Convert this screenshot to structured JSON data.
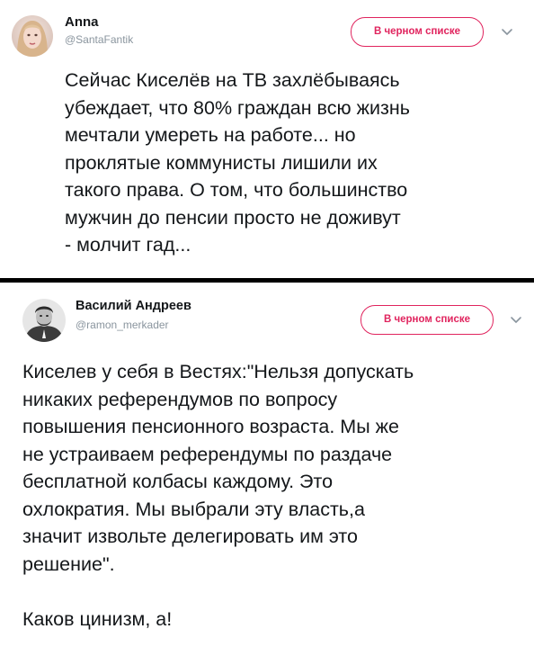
{
  "tweets": [
    {
      "display_name": "Anna",
      "handle": "@SantaFantik",
      "blocked_label": "В черном списке",
      "text_lines": [
        "Сейчас Киселёв на ТВ захлёбываясь",
        "убеждает, что 80% граждан всю жизнь",
        "мечтали умереть на работе... но",
        "проклятые коммунисты лишили их",
        "такого права. О том, что большинство",
        "мужчин до пенсии просто не доживут",
        "-  молчит гад..."
      ]
    },
    {
      "display_name": "Василий Андреев",
      "handle": "@ramon_merkader",
      "blocked_label": "В черном списке",
      "text_lines": [
        "Киселев у себя в Вестях:\"Нельзя допускать",
        "никаких референдумов по вопросу",
        "повышения пенсионного возраста. Мы же",
        "не устраиваем референдумы по раздаче",
        "бесплатной колбасы каждому. Это",
        "охлократия. Мы выбрали эту власть,а",
        "значит извольте делегировать им это",
        "решение\"."
      ],
      "text_lines_after_break": [
        "Каков цинизм, а!"
      ]
    }
  ],
  "colors": {
    "accent_blocked": "#e0245e",
    "handle_gray": "#8a959e",
    "text": "#14171a",
    "divider": "#000000"
  },
  "icons": {
    "menu_caret": "chevron-down-icon"
  }
}
